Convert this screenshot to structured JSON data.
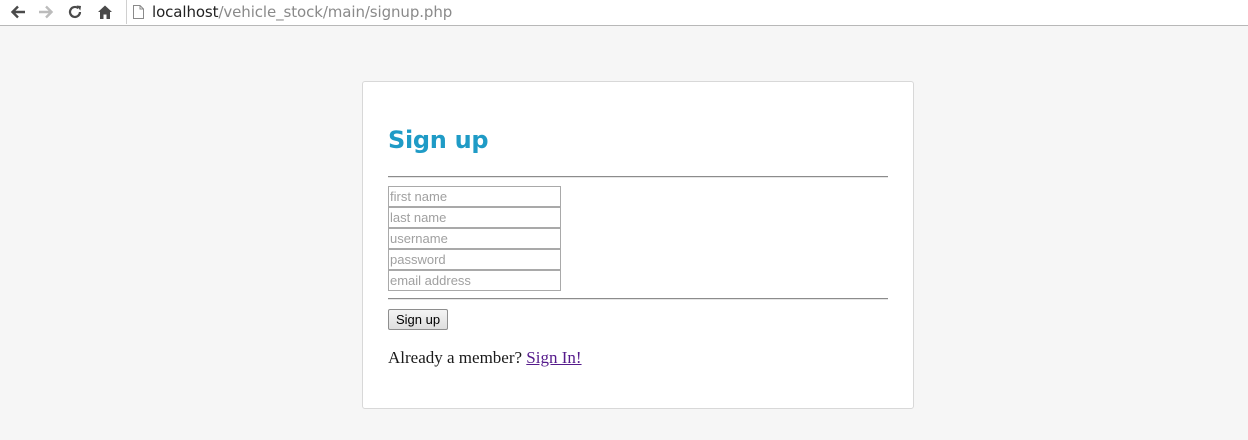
{
  "browser": {
    "back_icon": "arrow-left-icon",
    "forward_icon": "arrow-right-icon",
    "reload_icon": "reload-icon",
    "home_icon": "home-icon",
    "url_host": "localhost",
    "url_path": "/vehicle_stock/main/signup.php"
  },
  "form": {
    "title": "Sign up",
    "fields": {
      "first_name_placeholder": "first name",
      "last_name_placeholder": "last name",
      "username_placeholder": "username",
      "password_placeholder": "password",
      "email_placeholder": "email address"
    },
    "submit_label": "Sign up",
    "member_prompt": "Already a member?",
    "signin_link": "Sign In!"
  },
  "colors": {
    "title": "#1f9bc6",
    "visited_link": "#551a8b",
    "page_background": "#f6f6f6"
  }
}
